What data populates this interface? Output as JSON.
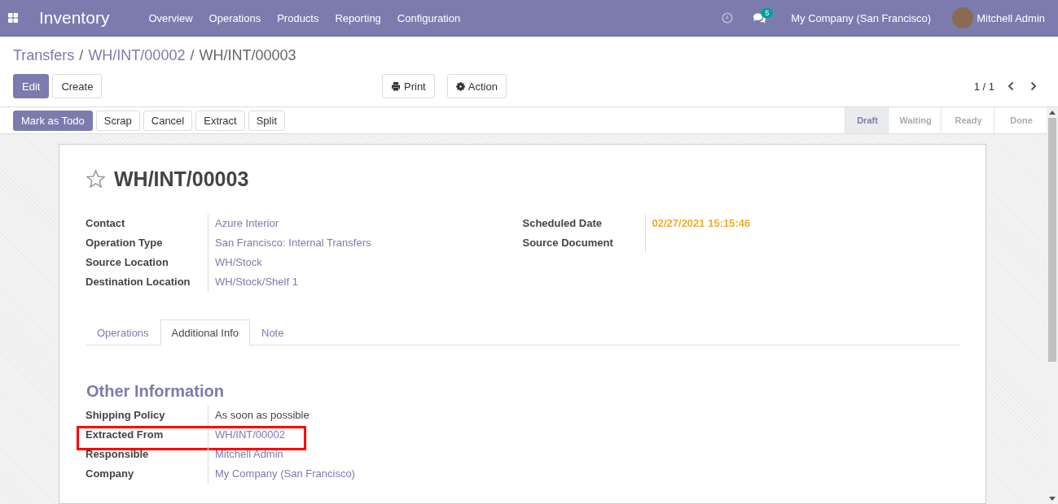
{
  "navbar": {
    "app_name": "Inventory",
    "menu": [
      "Overview",
      "Operations",
      "Products",
      "Reporting",
      "Configuration"
    ],
    "messages_badge": "5",
    "company": "My Company (San Francisco)",
    "user": "Mitchell Admin"
  },
  "breadcrumb": [
    {
      "label": "Transfers",
      "current": false
    },
    {
      "separator": "/",
      "label": "WH/INT/00002",
      "current": false
    },
    {
      "separator": "/",
      "label": "WH/INT/00003",
      "current": true
    }
  ],
  "control_buttons": [
    {
      "label": "Edit",
      "primary": true
    },
    {
      "label": "Create",
      "primary": false
    }
  ],
  "sidebar_buttons": [
    {
      "label": "Print",
      "kind": "print"
    },
    {
      "label": "Action",
      "kind": "action"
    }
  ],
  "pager": "1 / 1",
  "action_buttons": [
    {
      "label": "Mark as Todo",
      "primary": true
    },
    {
      "label": "Scrap",
      "primary": false
    },
    {
      "label": "Cancel",
      "primary": false
    },
    {
      "label": "Extract",
      "primary": false
    },
    {
      "label": "Split",
      "primary": false
    }
  ],
  "stages": [
    {
      "label": "Draft",
      "selected": true
    },
    {
      "label": "Waiting",
      "selected": false
    },
    {
      "label": "Ready",
      "selected": false
    },
    {
      "label": "Done",
      "selected": false
    }
  ],
  "record": {
    "title": "WH/INT/00003",
    "starred": false,
    "left_fields": [
      {
        "label": "Contact",
        "value": "Azure Interior",
        "kind": "link"
      },
      {
        "label": "Operation Type",
        "value": "San Francisco: Internal Transfers",
        "kind": "link"
      },
      {
        "label": "Source Location",
        "value": "WH/Stock",
        "kind": "link"
      },
      {
        "label": "Destination Location",
        "value": "WH/Stock/Shelf 1",
        "kind": "link"
      }
    ],
    "right_fields": [
      {
        "label": "Scheduled Date",
        "value": "02/27/2021 15:15:46",
        "kind": "date"
      },
      {
        "label": "Source Document",
        "kind": "empty"
      }
    ],
    "tabs": [
      {
        "label": "Operations",
        "selected": false
      },
      {
        "label": "Additional Info",
        "selected": true
      },
      {
        "label": "Note",
        "selected": false
      }
    ],
    "section_title": "Other Information",
    "info_fields": [
      {
        "label": "Shipping Policy",
        "value": "As soon as possible",
        "kind": "text",
        "highlighted": false
      },
      {
        "label": "Extracted From",
        "value": "WH/INT/00002",
        "kind": "link",
        "highlighted": true
      },
      {
        "label": "Responsible",
        "value": "Mitchell Admin",
        "kind": "link",
        "highlighted": false
      },
      {
        "label": "Company",
        "value": "My Company (San Francisco)",
        "kind": "link",
        "highlighted": false
      }
    ]
  }
}
